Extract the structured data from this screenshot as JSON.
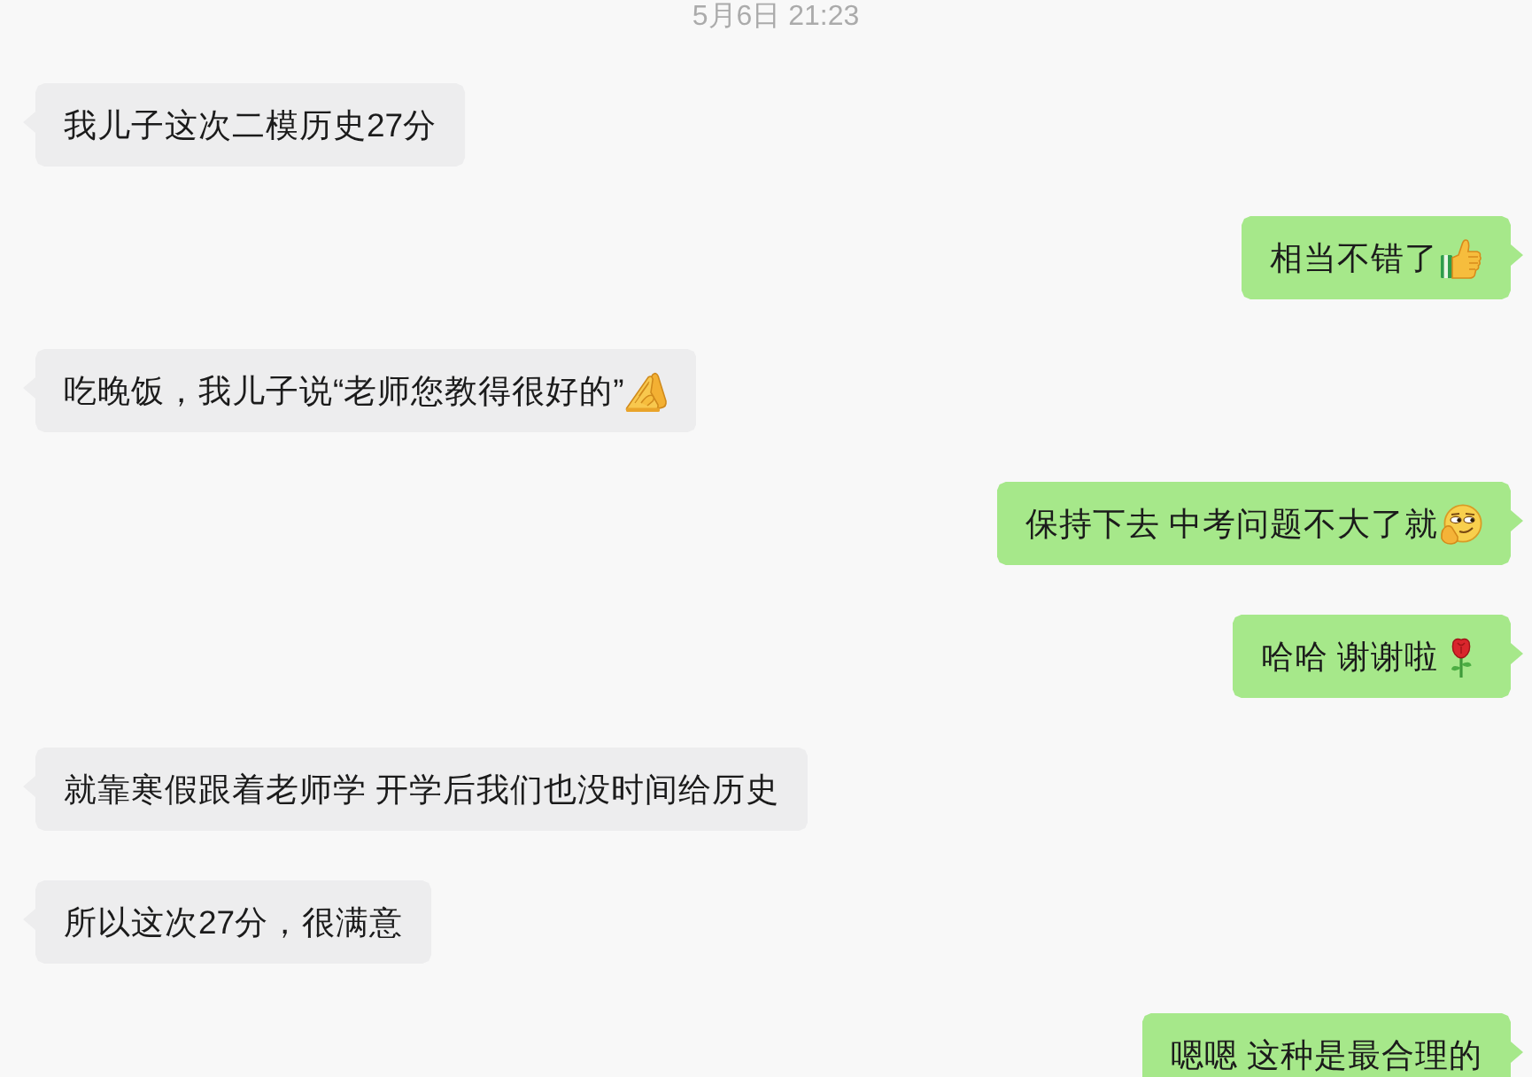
{
  "timestamp": "5月6日 21:23",
  "messages": [
    {
      "kind": "received",
      "text": "我儿子这次二模历史27分"
    },
    {
      "kind": "sent",
      "text": "相当不错了",
      "emoji": {
        "kind": "thumbsup"
      }
    },
    {
      "kind": "received",
      "text": "吃晚饭，我儿子说“老师您教得很好的”",
      "emoji": {
        "kind": "prayer"
      }
    },
    {
      "kind": "sent",
      "text": "保持下去 中考问题不大了就",
      "emoji": {
        "kind": "smirk"
      }
    },
    {
      "kind": "sent",
      "text": "哈哈 谢谢啦",
      "emoji": {
        "kind": "rose"
      }
    },
    {
      "kind": "received",
      "text": "就靠寒假跟着老师学 开学后我们也没时间给历史"
    },
    {
      "kind": "received",
      "text": "所以这次27分，很满意"
    },
    {
      "kind": "sent",
      "text": "嗯嗯 这种是最合理的"
    }
  ]
}
